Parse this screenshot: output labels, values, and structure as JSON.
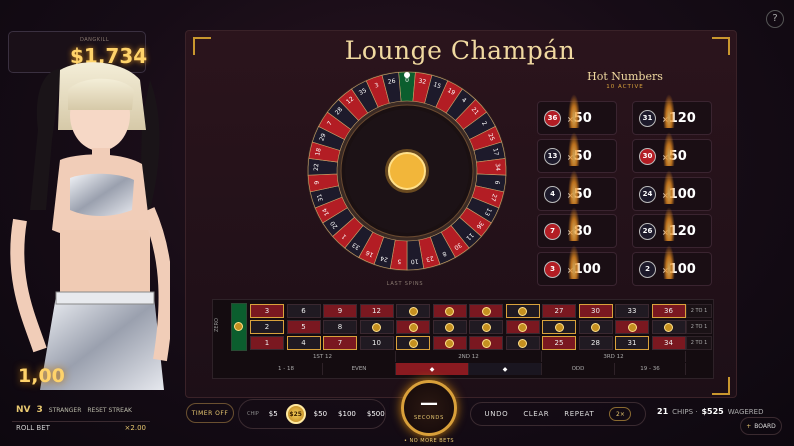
{
  "header": {
    "title": "Lounge Champán",
    "help_label": "?"
  },
  "player": {
    "name": "DANGKILL",
    "balance": "$1,734",
    "level_prefix": "NV",
    "level_value": "3",
    "level_label": "STRANGER",
    "resets_label": "RESET STREAK",
    "value_display": "1,00"
  },
  "roll_bet": {
    "label": "ROLL BET",
    "multiplier": "×2.00"
  },
  "hot_numbers": {
    "title": "Hot Numbers",
    "subtitle": "10 ACTIVE",
    "items": [
      {
        "number": "36",
        "color": "red",
        "multiplier": "50"
      },
      {
        "number": "31",
        "color": "black",
        "multiplier": "120"
      },
      {
        "number": "13",
        "color": "black",
        "multiplier": "50"
      },
      {
        "number": "30",
        "color": "red",
        "multiplier": "50"
      },
      {
        "number": "4",
        "color": "black",
        "multiplier": "50"
      },
      {
        "number": "24",
        "color": "black",
        "multiplier": "100"
      },
      {
        "number": "7",
        "color": "red",
        "multiplier": "80"
      },
      {
        "number": "26",
        "color": "black",
        "multiplier": "120"
      },
      {
        "number": "3",
        "color": "red",
        "multiplier": "100"
      },
      {
        "number": "2",
        "color": "black",
        "multiplier": "100"
      }
    ]
  },
  "wheel": {
    "sequence": [
      "0",
      "32",
      "15",
      "19",
      "4",
      "21",
      "2",
      "25",
      "17",
      "34",
      "6",
      "27",
      "13",
      "36",
      "11",
      "30",
      "8",
      "23",
      "10",
      "5",
      "24",
      "16",
      "33",
      "1",
      "20",
      "14",
      "31",
      "9",
      "22",
      "18",
      "29",
      "7",
      "28",
      "12",
      "35",
      "3",
      "26"
    ],
    "red_numbers": [
      1,
      3,
      5,
      7,
      9,
      12,
      14,
      16,
      18,
      19,
      21,
      23,
      25,
      27,
      30,
      32,
      34,
      36
    ],
    "last_spins_label": "LAST SPINS"
  },
  "board": {
    "zero_label": "ZERO",
    "row_top": [
      "3",
      "6",
      "9",
      "12",
      "15",
      "18",
      "21",
      "24",
      "27",
      "30",
      "33",
      "36"
    ],
    "row_mid": [
      "2",
      "5",
      "8",
      "11",
      "14",
      "17",
      "20",
      "23",
      "26",
      "29",
      "32",
      "35"
    ],
    "row_bot": [
      "1",
      "4",
      "7",
      "10",
      "13",
      "16",
      "19",
      "22",
      "25",
      "28",
      "31",
      "34"
    ],
    "column_label": "2 TO 1",
    "dozens": [
      "1ST 12",
      "2ND 12",
      "3RD 12"
    ],
    "outside": [
      "1 - 18",
      "EVEN",
      "",
      "",
      "ODD",
      "19 - 36"
    ]
  },
  "controls": {
    "timer_button": "TIMER OFF",
    "chip_label": "CHIP",
    "chips": [
      "$5",
      "$25",
      "$50",
      "$100",
      "$500"
    ],
    "selected_chip": "$25",
    "timer_value": "—",
    "timer_label": "SECONDS",
    "no_more_bets": "• NO MORE BETS",
    "undo": "UNDO",
    "clear": "CLEAR",
    "repeat": "REPEAT",
    "double": "2×",
    "chips_count": "21",
    "chips_text": "CHIPS ·",
    "wagered_amount": "$525",
    "wagered_text": "WAGERED",
    "board_button": "BOARD"
  },
  "colors": {
    "accent": "#d9a23c",
    "red": "#b31d24",
    "black": "#1d1a2b",
    "green": "#0b5e2e"
  }
}
